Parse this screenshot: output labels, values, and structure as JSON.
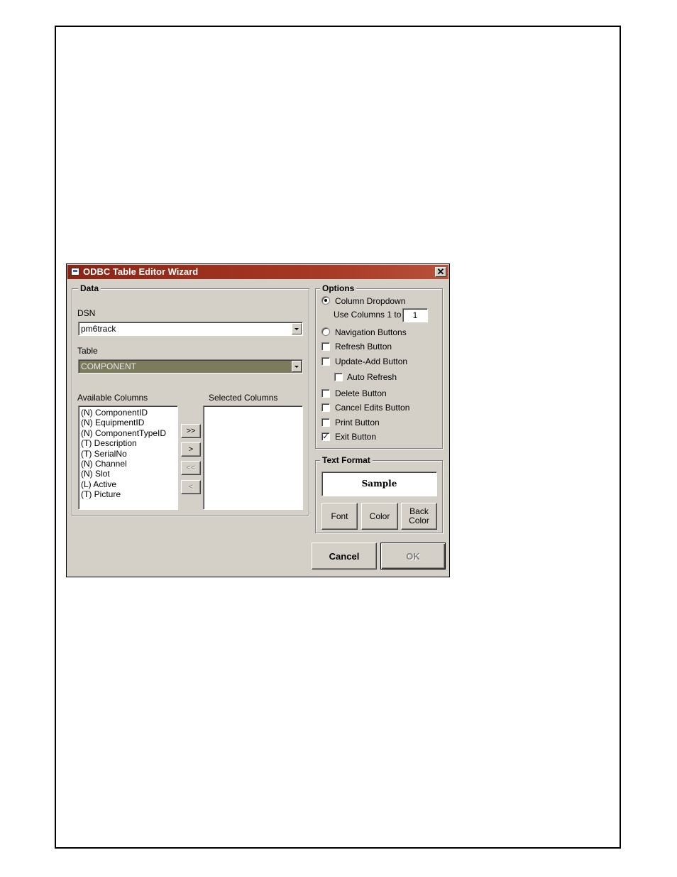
{
  "window": {
    "title": "ODBC Table Editor Wizard",
    "close_glyph": "✕"
  },
  "data_group": {
    "legend": "Data",
    "dsn_label": "DSN",
    "dsn_value": "pm6track",
    "table_label": "Table",
    "table_value": "COMPONENT",
    "available_label": "Available Columns",
    "selected_label": "Selected Columns",
    "available_columns": [
      "(N) ComponentID",
      "(N) EquipmentID",
      "(N) ComponentTypeID",
      "(T) Description",
      "(T) SerialNo",
      "(N) Channel",
      "(N) Slot",
      "(L) Active",
      "(T) Picture"
    ],
    "selected_columns": [],
    "move_buttons": {
      "add_all": ">>",
      "add": ">",
      "remove_all": "<<",
      "remove": "<"
    }
  },
  "options_group": {
    "legend": "Options",
    "column_dropdown": {
      "label": "Column Dropdown",
      "selected": true
    },
    "use_columns_label": "Use Columns 1 to",
    "use_columns_value": "1",
    "navigation_buttons": {
      "label": "Navigation Buttons",
      "selected": false
    },
    "refresh_button": {
      "label": "Refresh Button",
      "checked": false
    },
    "update_add_button": {
      "label": "Update-Add Button",
      "checked": false
    },
    "auto_refresh": {
      "label": "Auto Refresh",
      "checked": false
    },
    "delete_button": {
      "label": "Delete Button",
      "checked": false
    },
    "cancel_edits_button": {
      "label": "Cancel Edits Button",
      "checked": false
    },
    "print_button": {
      "label": "Print Button",
      "checked": false
    },
    "exit_button": {
      "label": "Exit Button",
      "checked": true,
      "check_glyph": "✓"
    }
  },
  "text_format": {
    "legend": "Text Format",
    "sample": "Sample",
    "font_label": "Font",
    "color_label": "Color",
    "back_color_label_1": "Back",
    "back_color_label_2": "Color"
  },
  "footer": {
    "cancel_label": "Cancel",
    "ok_label": "OK"
  },
  "colors": {
    "title_bar": "#a83a26",
    "dialog_bg": "#d4d0c8",
    "table_combo_bg": "#7c7b5e"
  }
}
